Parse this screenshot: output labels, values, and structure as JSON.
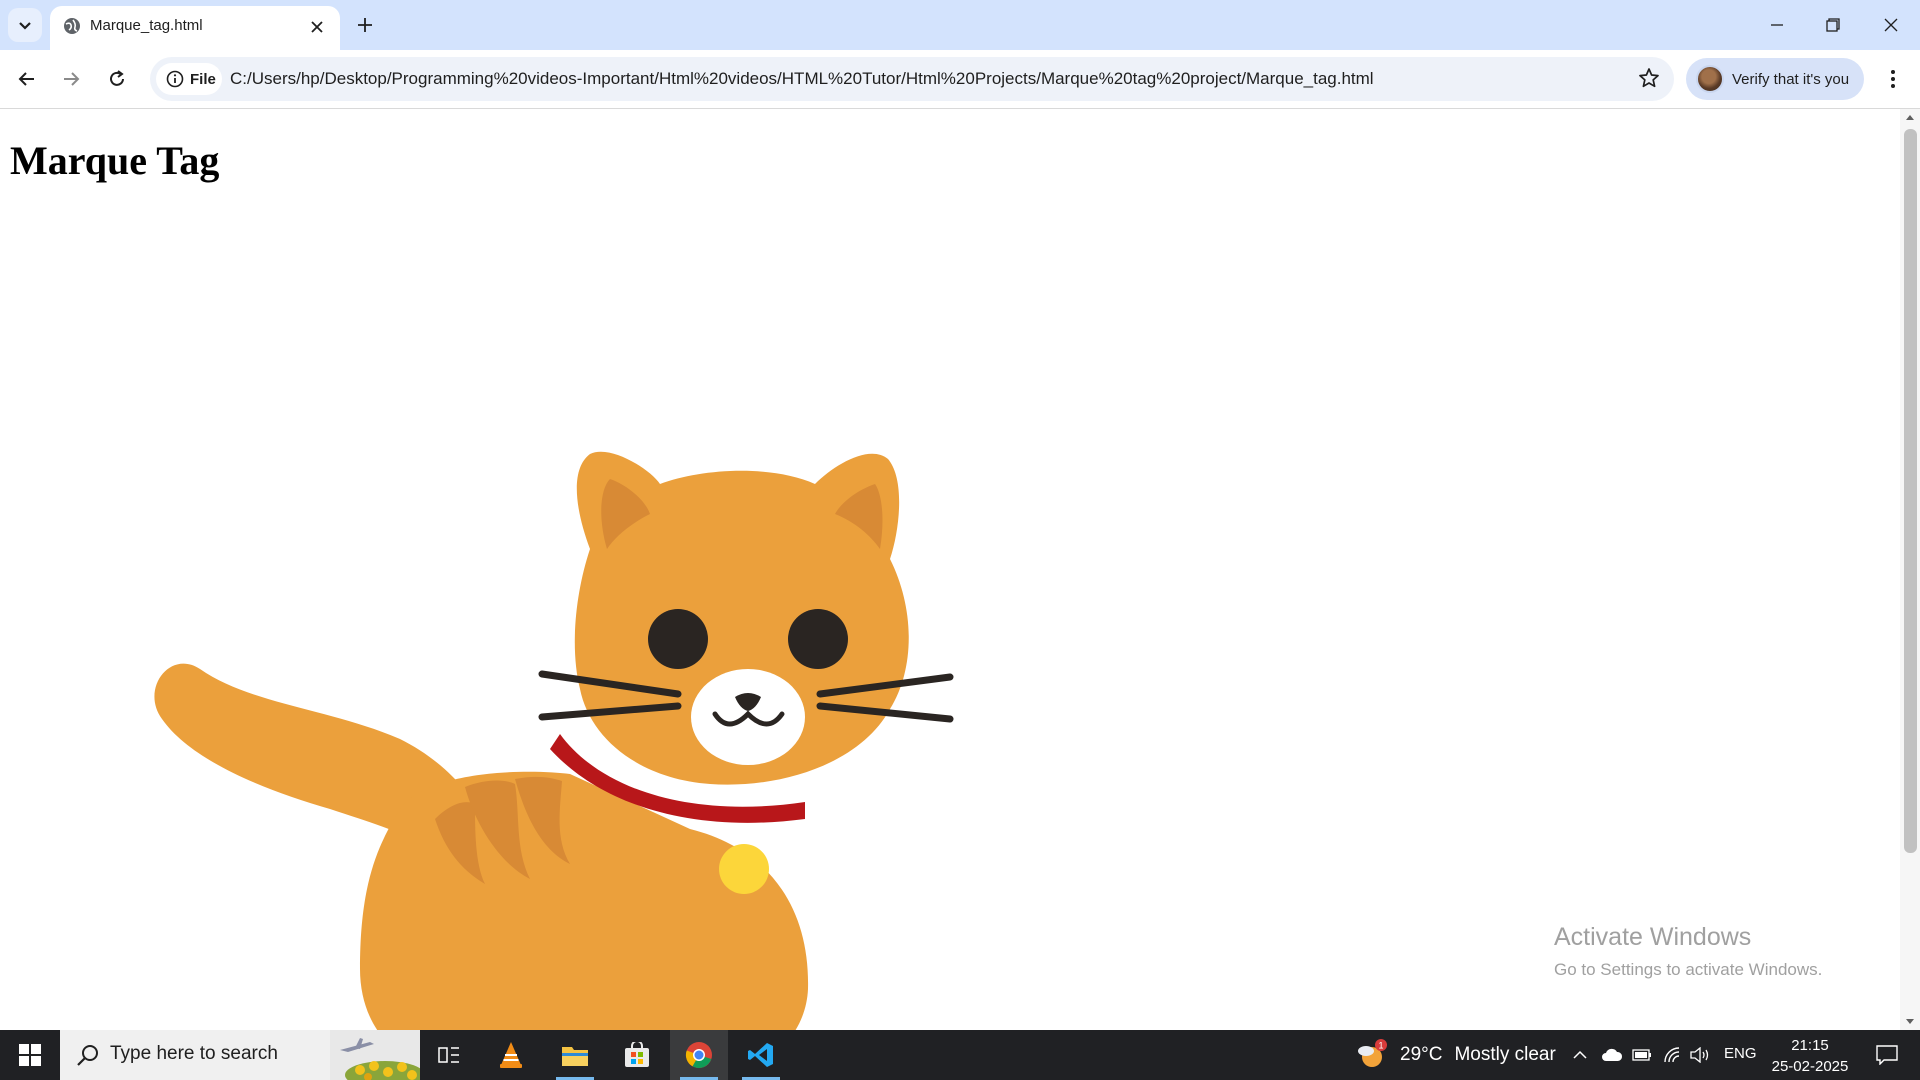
{
  "browser": {
    "tab": {
      "title": "Marque_tag.html"
    },
    "address_bar": {
      "chip_label": "File",
      "url": "C:/Users/hp/Desktop/Programming%20videos-Important/Html%20videos/HTML%20Tutor/Html%20Projects/Marque%20tag%20project/Marque_tag.html"
    },
    "profile": {
      "verify_label": "Verify that it's you"
    }
  },
  "page": {
    "heading": "Marque Tag",
    "image": {
      "description_icon": "cat-icon",
      "colors": {
        "body": "#eba03c",
        "stripes": "#d88a35",
        "collar": "#b8171a",
        "bell": "#fcd63a"
      }
    }
  },
  "watermark": {
    "title": "Activate Windows",
    "subtitle": "Go to Settings to activate Windows."
  },
  "taskbar": {
    "search_placeholder": "Type here to search",
    "weather": {
      "temperature": "29°C",
      "condition": "Mostly clear",
      "badge": "1"
    },
    "language": "ENG",
    "time": "21:15",
    "date": "25-02-2025",
    "pinned": [
      "task-view-icon",
      "vlc-icon",
      "file-explorer-icon",
      "microsoft-store-icon",
      "chrome-icon",
      "vscode-icon"
    ]
  }
}
